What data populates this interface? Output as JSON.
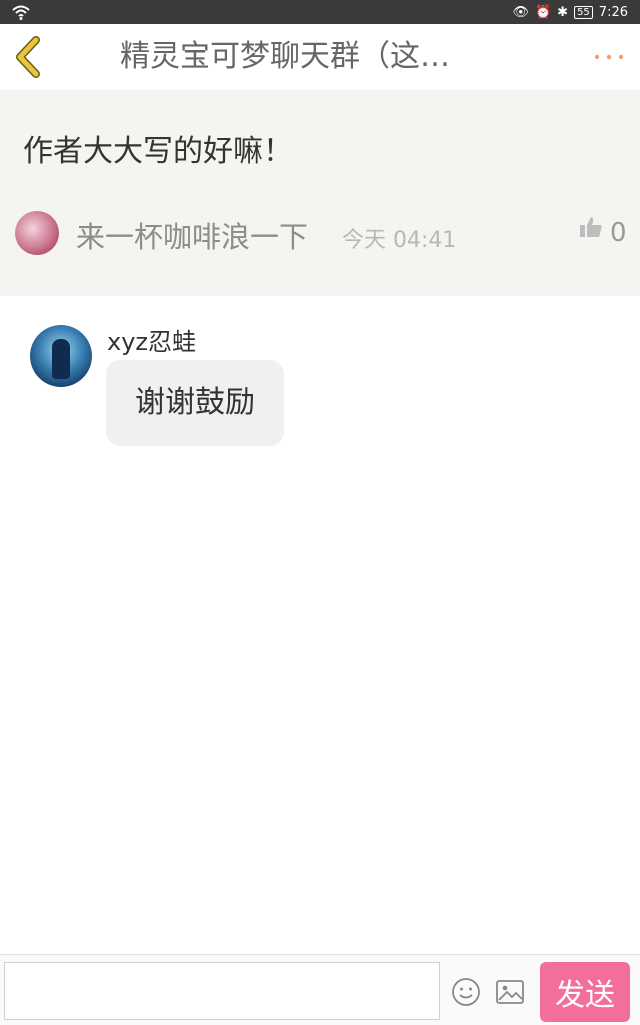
{
  "status_bar": {
    "time": "7:26",
    "battery": "55"
  },
  "header": {
    "title": "精灵宝可梦聊天群（这…",
    "back_icon": "back-chevron-icon",
    "more_icon": "more-dots-icon"
  },
  "post": {
    "text": "作者大大写的好嘛！",
    "author": "来一杯咖啡浪一下",
    "time": "今天 04:41",
    "like_count": "0"
  },
  "reply": {
    "username": "xyz忍蛙",
    "message": "谢谢鼓励"
  },
  "input_bar": {
    "placeholder": "",
    "send_label": "发送"
  },
  "colors": {
    "accent": "#f36f9b",
    "back_icon": "#e9c640",
    "post_bg": "#f4f4f0",
    "more_dots": "#f0a070"
  }
}
